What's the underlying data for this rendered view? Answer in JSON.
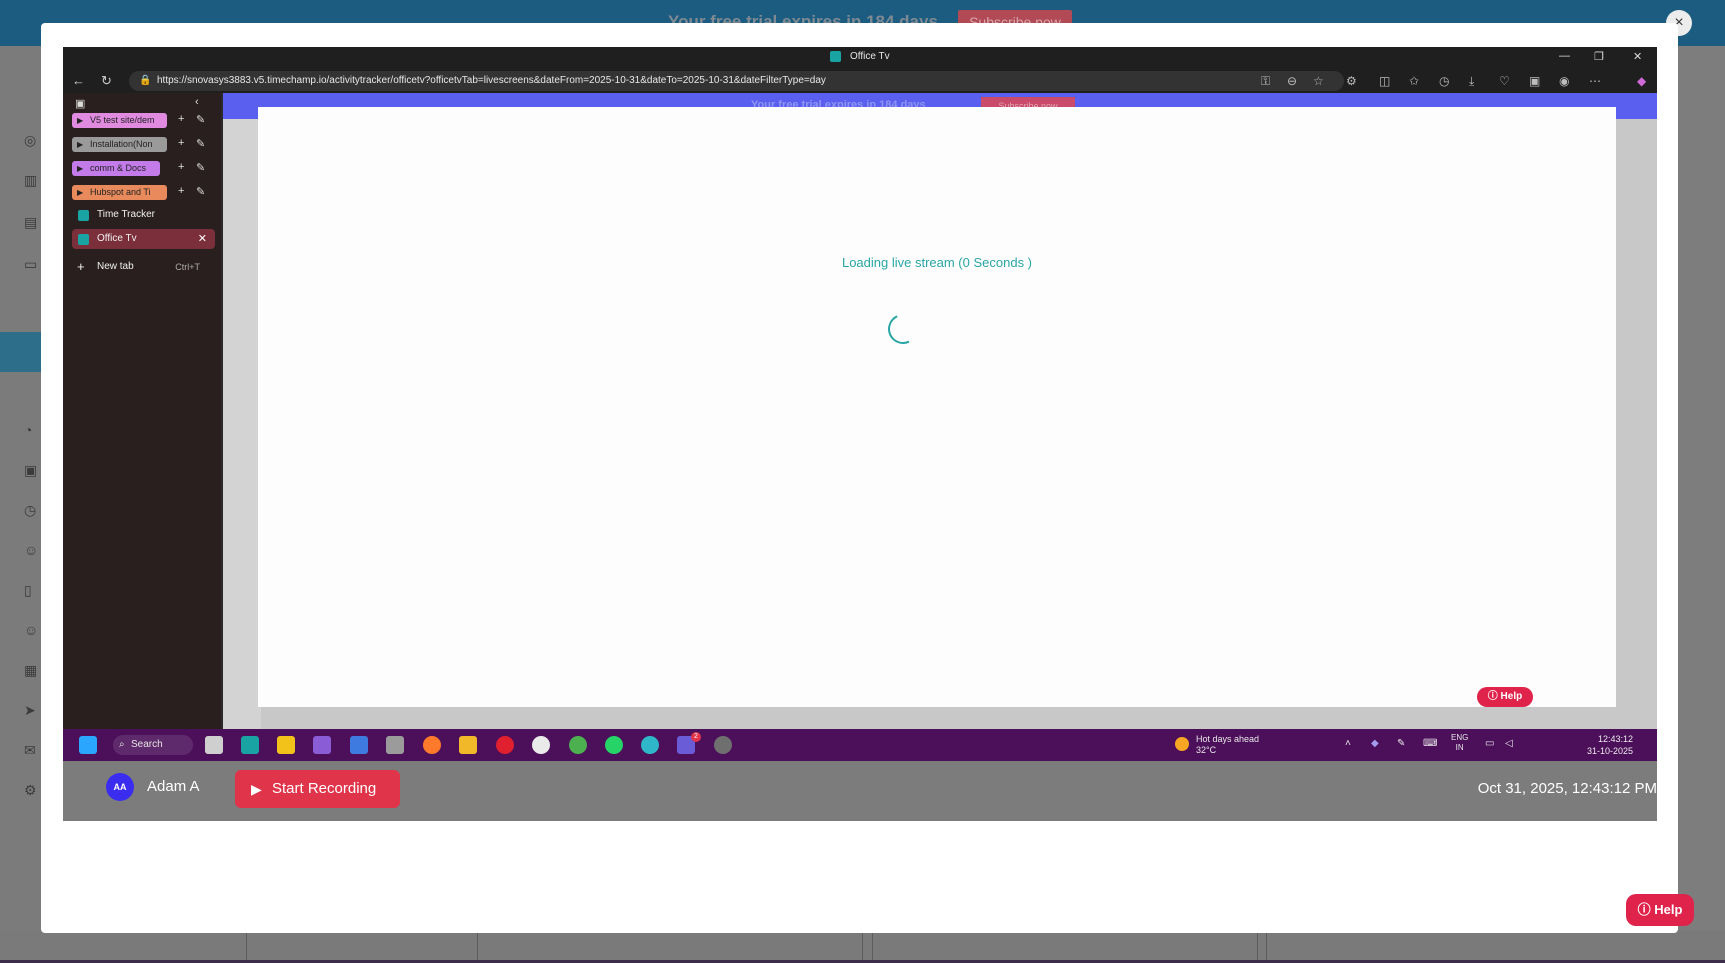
{
  "backdrop": {
    "banner_text": "Your free trial expires in 184 days",
    "banner_button": "Subscribe now",
    "close_label": "×"
  },
  "browser": {
    "window_title": "Office Tv",
    "url": "https://snovasys3883.v5.timechamp.io/activitytracker/officetv?officetvTab=livescreens&dateFrom=2025-10-31&dateTo=2025-10-31&dateFilterType=day",
    "tab_groups": [
      {
        "label": "V5 test site/dem",
        "color": "#e08ae0"
      },
      {
        "label": "Installation(Non",
        "color": "#9a9a9a"
      },
      {
        "label": "comm & Docs",
        "color": "#c27be8"
      },
      {
        "label": "Hubspot and Ti",
        "color": "#e88a5c"
      }
    ],
    "tabs": [
      {
        "label": "Time Tracker"
      },
      {
        "label": "Office Tv"
      }
    ],
    "new_tab": {
      "label": "New tab",
      "shortcut": "Ctrl+T"
    }
  },
  "inner_page": {
    "banner_text": "Your free trial expires in 184 days",
    "banner_button": "Subscribe now",
    "loading_text": "Loading live stream (0 Seconds )",
    "help_label": "Help"
  },
  "taskbar": {
    "search_label": "Search",
    "weather_title": "Hot days ahead",
    "weather_temp": "32°C",
    "language": "ENG",
    "region": "IN",
    "time": "12:43:12",
    "date": "31-10-2025",
    "badge_count": "2"
  },
  "infobar": {
    "avatar_initials": "AA",
    "user_name": "Adam A",
    "record_label": "Start Recording",
    "timestamp": "Oct 31, 2025, 12:43:12 PM"
  },
  "help_label": "Help"
}
